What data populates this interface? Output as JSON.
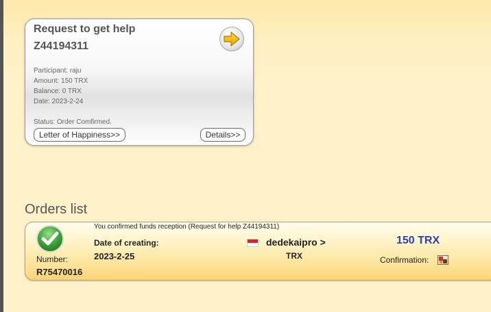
{
  "request_card": {
    "title": "Request to get help",
    "id": "Z44194311",
    "participant": "Participant: raju",
    "amount": "Amount: 150 TRX",
    "balance": "Balance: 0 TRX",
    "date": "Date: 2023-2-24",
    "status": "Status: Order Comfirmed.",
    "letter_button": "Letter of Happiness>>",
    "details_button": "Details>>"
  },
  "orders": {
    "title": "Orders list",
    "items": [
      {
        "message": "You confirmed funds reception (Request for help Z44194311)",
        "number_label": "Number:",
        "number": "R75470016",
        "date_label": "Date of creating:",
        "date": "2023-2-25",
        "recipient": "dedekaipro >",
        "currency": "TRX",
        "amount": "150 TRX",
        "confirmation_label": "Confirmation:"
      }
    ]
  },
  "colors": {
    "amount_blue": "#2a3fb5",
    "check_green": "#3fa53c"
  },
  "icons": {
    "next": "arrow-right-icon",
    "status": "check-icon",
    "flag": "indonesia-flag-icon",
    "confirmation": "confirmation-image-icon"
  }
}
